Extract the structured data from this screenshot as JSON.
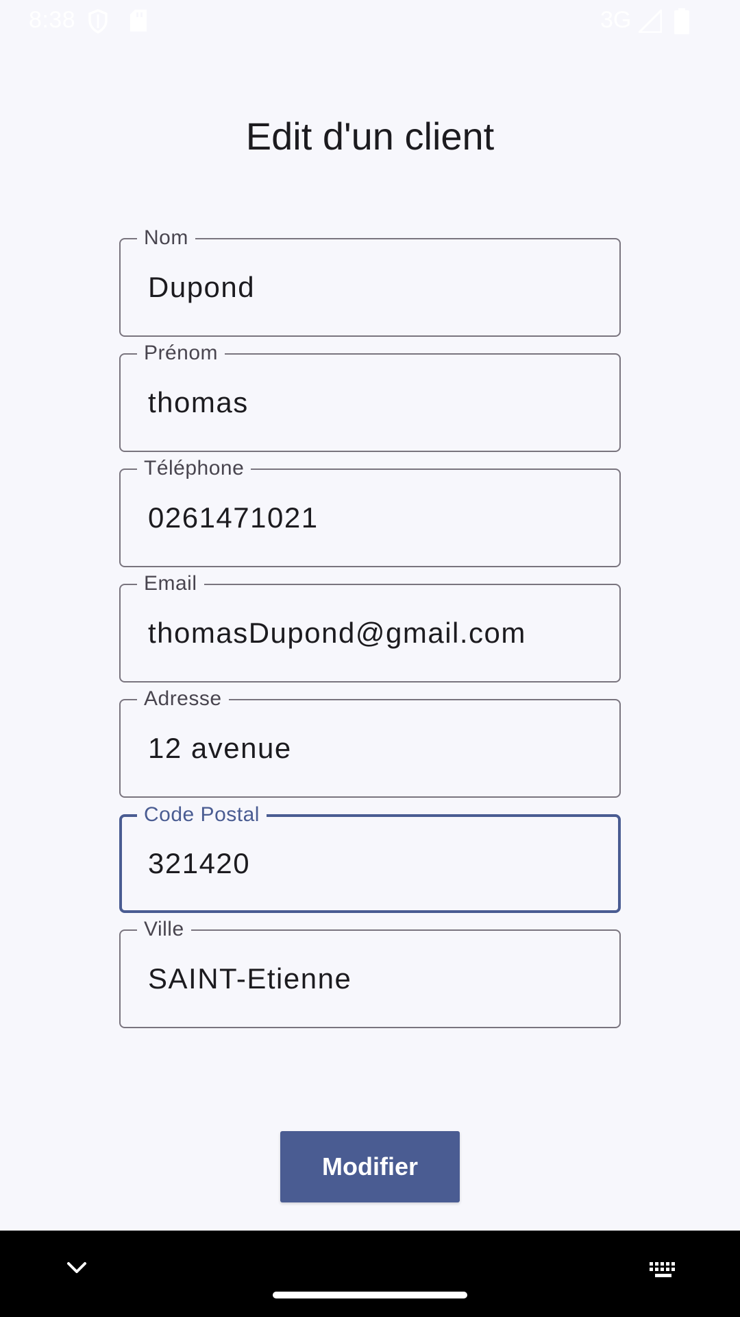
{
  "status_bar": {
    "time": "8:38",
    "network": "3G",
    "icons": [
      "shield-icon",
      "sd-card-icon",
      "signal-icon",
      "battery-icon"
    ]
  },
  "page": {
    "title": "Edit d'un client"
  },
  "form": {
    "fields": [
      {
        "label": "Nom",
        "value": "Dupond"
      },
      {
        "label": "Prénom",
        "value": "thomas"
      },
      {
        "label": "Téléphone",
        "value": "0261471021"
      },
      {
        "label": "Email",
        "value": "thomasDupond@gmail.com"
      },
      {
        "label": "Adresse",
        "value": "12 avenue"
      },
      {
        "label": "Code Postal",
        "value": "321420",
        "focused": true
      },
      {
        "label": "Ville",
        "value": "SAINT-Etienne"
      }
    ]
  },
  "actions": {
    "submit_label": "Modifier"
  },
  "colors": {
    "background": "#f7f7fc",
    "accent": "#4a5c92",
    "outline": "#79747e",
    "text": "#1c1b1f"
  },
  "nav_bar": {
    "icons": [
      "chevron-down-icon",
      "home-handle",
      "keyboard-icon"
    ]
  }
}
